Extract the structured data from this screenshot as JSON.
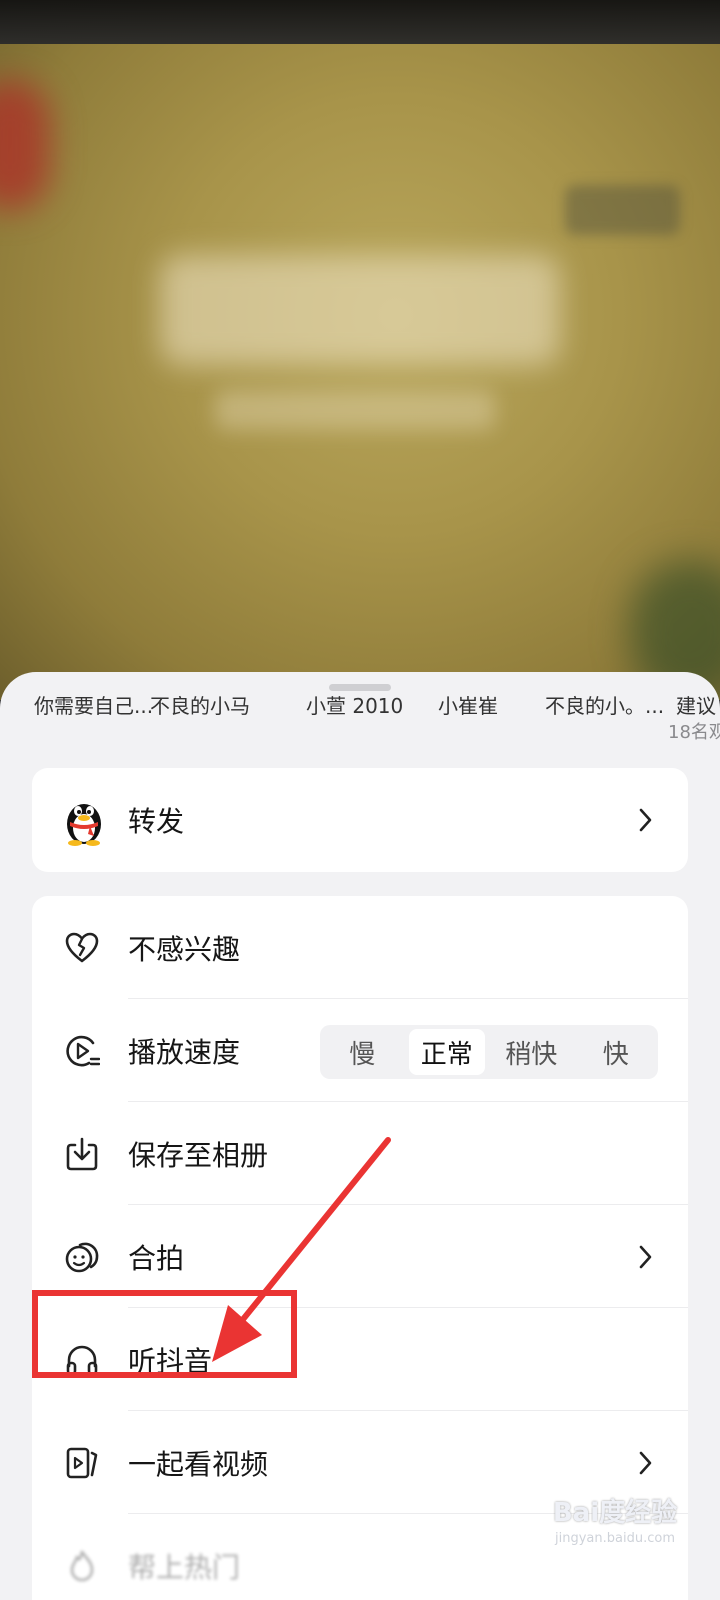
{
  "share_targets": [
    "你需要自己...",
    "不良的小马",
    "小萱 2010",
    "小崔崔",
    "不良的小。...",
    "建议"
  ],
  "viewer_count": "18名观",
  "forward": {
    "label": "转发",
    "icon": "qq-penguin-icon"
  },
  "menu": {
    "not_interested": "不感兴趣",
    "playback_speed": {
      "label": "播放速度",
      "options": [
        "慢",
        "正常",
        "稍快",
        "快"
      ],
      "selected": "正常"
    },
    "save_to_album": "保存至相册",
    "duet": "合拍",
    "listen_douyin": "听抖音",
    "watch_together": "一起看视频",
    "partial_item": "帮上热门"
  },
  "colors": {
    "annotation_red": "#ea3433",
    "sheet_bg": "#f2f2f4",
    "card_bg": "#ffffff"
  },
  "watermark": {
    "brand": "Bai度经验",
    "url": "jingyan.baidu.com"
  }
}
